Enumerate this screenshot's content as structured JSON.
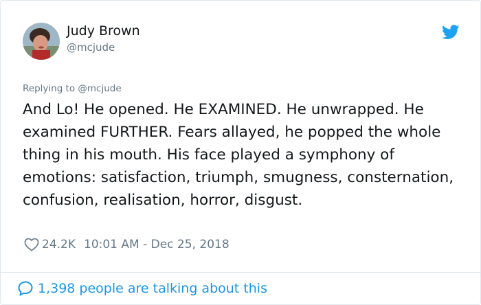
{
  "author": {
    "name": "Judy Brown",
    "handle": "@mcjude",
    "avatar_icon": "profile-photo"
  },
  "tweet": {
    "reply_to": "Replying to @mcjude",
    "text": "And Lo! He opened. He EXAMINED. He unwrapped. He examined FURTHER. Fears allayed, he popped the whole thing in his mouth. His face played a symphony of emotions: satisfaction, triumph, smugness, consternation, confusion, realisation, horror, disgust.",
    "likes": "24.2K",
    "timestamp": "10:01 AM - Dec 25, 2018"
  },
  "footer": {
    "talking_label": "1,398 people are talking about this"
  },
  "colors": {
    "accent": "#1da1f2",
    "link": "#1b95e0",
    "muted": "#657786",
    "text": "#14171a",
    "border": "#e1e8ed"
  },
  "icons": [
    "twitter-bird-icon",
    "heart-icon",
    "speech-bubble-icon"
  ]
}
